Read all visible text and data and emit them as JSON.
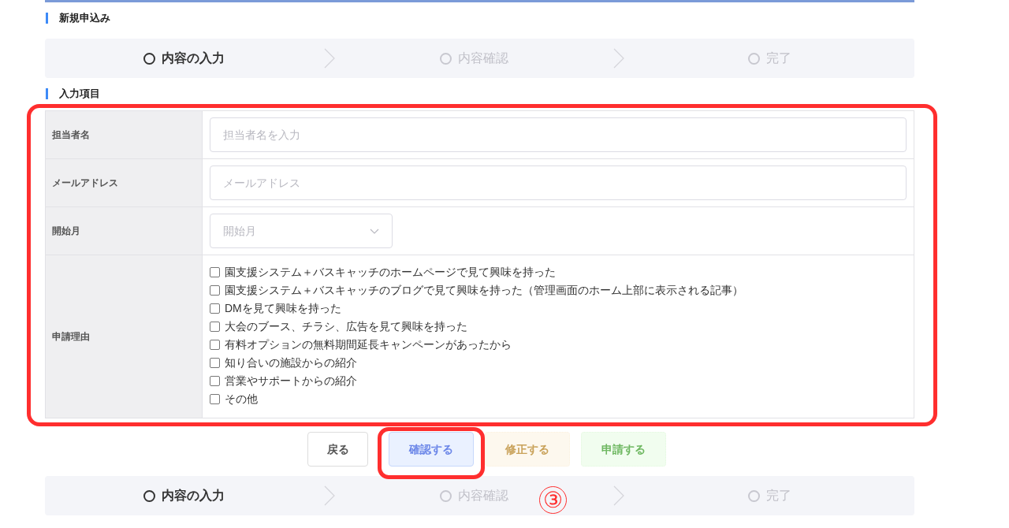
{
  "heading": "新規申込み",
  "stepper_top": [
    {
      "label": "内容の入力",
      "selected": true
    },
    {
      "label": "内容確認",
      "selected": false
    },
    {
      "label": "完了",
      "selected": false
    }
  ],
  "section": "入力項目",
  "fields": [
    {
      "label": "担当者名",
      "kind": "text",
      "placeholder": "担当者名を入力"
    },
    {
      "label": "メールアドレス",
      "kind": "text",
      "placeholder": "メールアドレス"
    },
    {
      "label": "開始月",
      "kind": "select",
      "placeholder": "開始月"
    },
    {
      "label": "申請理由",
      "kind": "checklist",
      "options": [
        {
          "label": "園支援システム＋バスキャッチのホームページで見て興味を持った",
          "checked": false
        },
        {
          "label": "園支援システム＋バスキャッチのブログで見て興味を持った（管理画面のホーム上部に表示される記事）",
          "checked": false
        },
        {
          "label": "DMを見て興味を持った",
          "checked": false
        },
        {
          "label": "大会のブース、チラシ、広告を見て興味を持った",
          "checked": false
        },
        {
          "label": "有料オプションの無料期間延長キャンペーンがあったから",
          "checked": false
        },
        {
          "label": "知り合いの施設からの紹介",
          "checked": false
        },
        {
          "label": "営業やサポートからの紹介",
          "checked": false
        },
        {
          "label": "その他",
          "checked": false
        }
      ]
    }
  ],
  "buttons": [
    {
      "label": "戻る",
      "kind": "back",
      "disabled": false
    },
    {
      "label": "確認する",
      "kind": "confirm",
      "disabled": false
    },
    {
      "label": "修正する",
      "kind": "edit",
      "disabled": true
    },
    {
      "label": "申請する",
      "kind": "submit",
      "disabled": true
    }
  ],
  "stepper_bottom": [
    {
      "label": "内容の入力",
      "selected": true
    },
    {
      "label": "内容確認",
      "selected": false
    },
    {
      "label": "完了",
      "selected": false
    }
  ],
  "annotation": {
    "step_number": "③"
  }
}
